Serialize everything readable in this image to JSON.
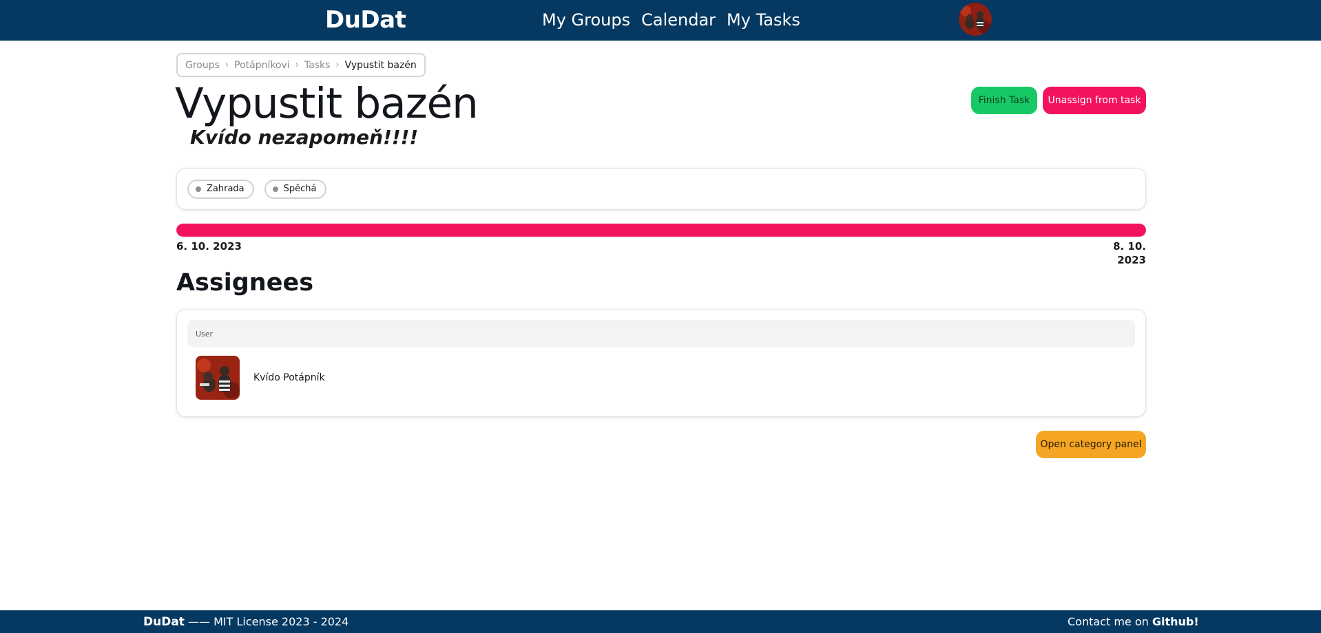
{
  "nav": {
    "brand": "DuDat",
    "links": [
      "My Groups",
      "Calendar",
      "My Tasks"
    ],
    "avatar_icon": "user-avatar-bear-photo"
  },
  "breadcrumb": [
    "Groups",
    "Potápníkovi",
    "Tasks",
    "Vypustit bazén"
  ],
  "task": {
    "title": "Vypustit bazén",
    "description": "Kvído nezapomeň!!!!",
    "finish_label": "Finish Task",
    "unassign_label": "Unassign from task",
    "tags": [
      "Zahrada",
      "Spěchá"
    ],
    "progress_fraction": 1.0,
    "start_date": "6. 10. 2023",
    "end_date": "8. 10. 2023"
  },
  "assignees": {
    "title": "Assignees",
    "column_header": "User",
    "rows": [
      {
        "name": "Kvído Potápník"
      }
    ]
  },
  "category_panel_label": "Open category panel",
  "footer": {
    "brand": "DuDat",
    "license": "—— MIT License 2023 - 2024",
    "contact_prefix": "Contact me on",
    "contact_link": "Github!"
  },
  "colors": {
    "navbar": "#063961",
    "success": "#17c964",
    "danger": "#f31260",
    "warning": "#f5a524"
  }
}
